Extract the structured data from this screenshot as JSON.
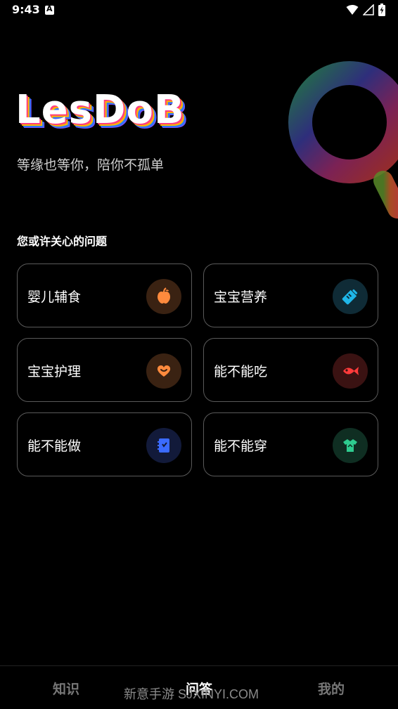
{
  "status_bar": {
    "time": "9:43"
  },
  "app": {
    "title": "LesDoB",
    "slogan": "等缘也等你，陪你不孤单"
  },
  "section": {
    "title": "您或许关心的问题"
  },
  "cards": [
    {
      "label": "婴儿辅食",
      "icon": "apple-icon",
      "icon_color": "#ff8a3d",
      "icon_bg": "#3a2212"
    },
    {
      "label": "宝宝营养",
      "icon": "baby-bottle-icon",
      "icon_color": "#1fb6e8",
      "icon_bg": "#0f2b36"
    },
    {
      "label": "宝宝护理",
      "icon": "heart-hand-icon",
      "icon_color": "#ff8a3d",
      "icon_bg": "#3a2212"
    },
    {
      "label": "能不能吃",
      "icon": "fish-icon",
      "icon_color": "#ff3b3b",
      "icon_bg": "#3a1212"
    },
    {
      "label": "能不能做",
      "icon": "notebook-icon",
      "icon_color": "#3b6bff",
      "icon_bg": "#121a3a"
    },
    {
      "label": "能不能穿",
      "icon": "shirt-icon",
      "icon_color": "#2ecc8f",
      "icon_bg": "#0f2e22"
    }
  ],
  "nav": {
    "items": [
      {
        "label": "知识",
        "active": false
      },
      {
        "label": "问答",
        "active": true
      },
      {
        "label": "我的",
        "active": false
      }
    ]
  },
  "watermark": "新意手游 SJXINYI.COM",
  "colors": {
    "background": "#000000",
    "card_border": "#5a5a5a",
    "nav_inactive": "#777777"
  }
}
